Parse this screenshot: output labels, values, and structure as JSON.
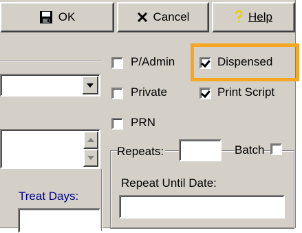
{
  "toolbar": {
    "ok_label": "OK",
    "cancel_label": "Cancel",
    "help_label": "Help"
  },
  "checkboxes": {
    "padmin": {
      "label": "P/Admin",
      "checked": false
    },
    "dispensed": {
      "label": "Dispensed",
      "checked": true
    },
    "private": {
      "label": "Private",
      "checked": false
    },
    "print_script": {
      "label": "Print Script",
      "checked": true
    },
    "prn": {
      "label": "PRN",
      "checked": false
    },
    "batch": {
      "label": "Batch",
      "checked": false
    }
  },
  "fields": {
    "repeats_label": "Repeats:",
    "repeats_value": "",
    "repeat_until_label": "Repeat Until Date:",
    "repeat_until_value": "",
    "treat_days_label": "Treat Days:",
    "treat_days_value": "",
    "combo_value": "",
    "list_value": ""
  },
  "colors": {
    "highlight": "#f5a623",
    "face": "#d4d0c8"
  }
}
